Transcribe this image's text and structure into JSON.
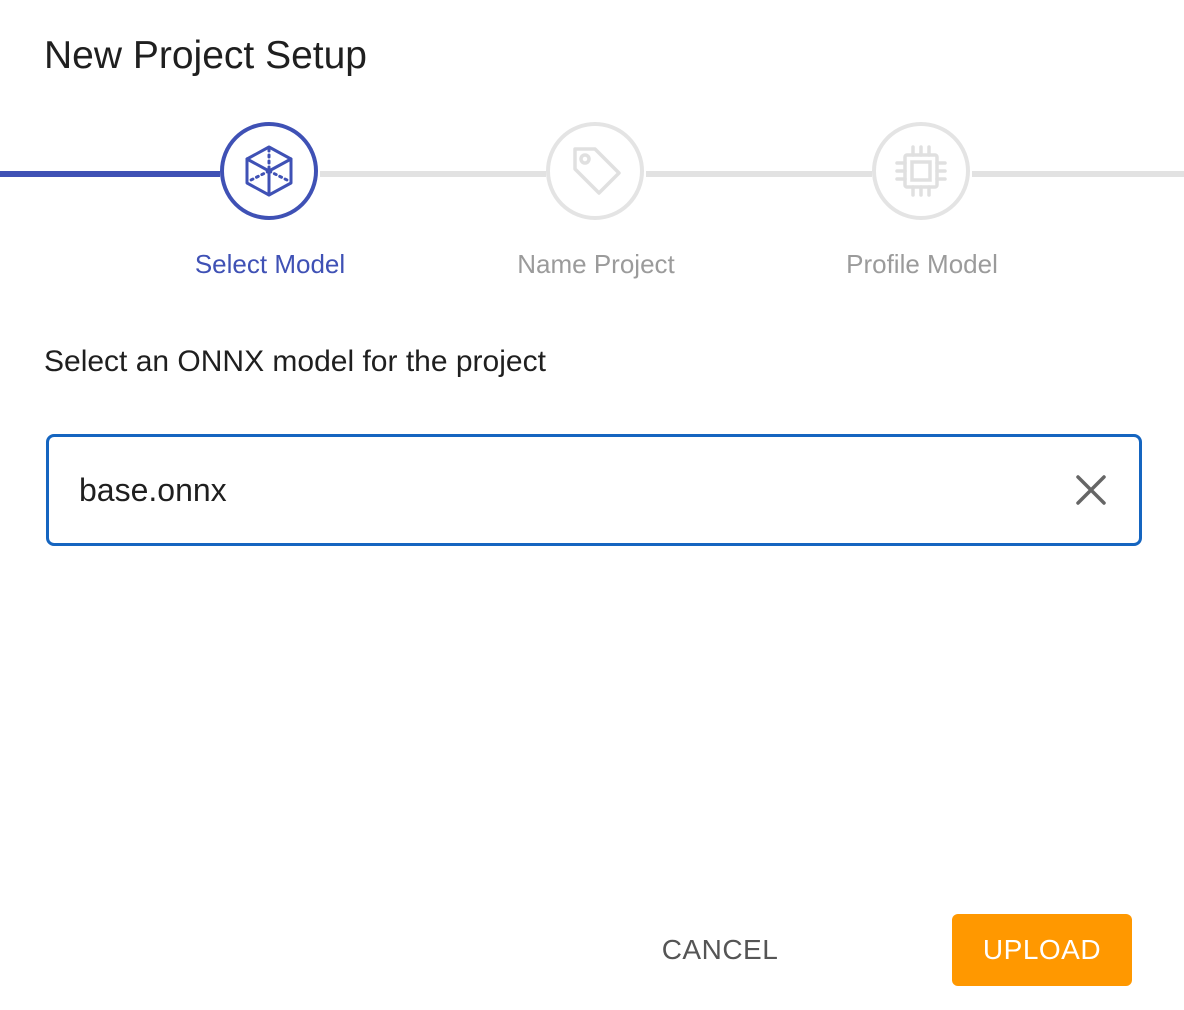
{
  "dialog": {
    "title": "New Project Setup"
  },
  "stepper": {
    "steps": [
      {
        "label": "Select Model",
        "state": "active",
        "icon": "cube-icon"
      },
      {
        "label": "Name Project",
        "state": "inactive",
        "icon": "tag-icon"
      },
      {
        "label": "Profile Model",
        "state": "inactive",
        "icon": "chip-icon"
      }
    ]
  },
  "form": {
    "prompt": "Select an ONNX model for the project",
    "file_value": "base.onnx",
    "clear_icon": "close-icon"
  },
  "actions": {
    "cancel_label": "CANCEL",
    "upload_label": "UPLOAD"
  },
  "colors": {
    "accent": "#3f51b5",
    "field_border": "#1565c0",
    "primary_button": "#ff9800",
    "inactive": "#9b9b9b"
  }
}
